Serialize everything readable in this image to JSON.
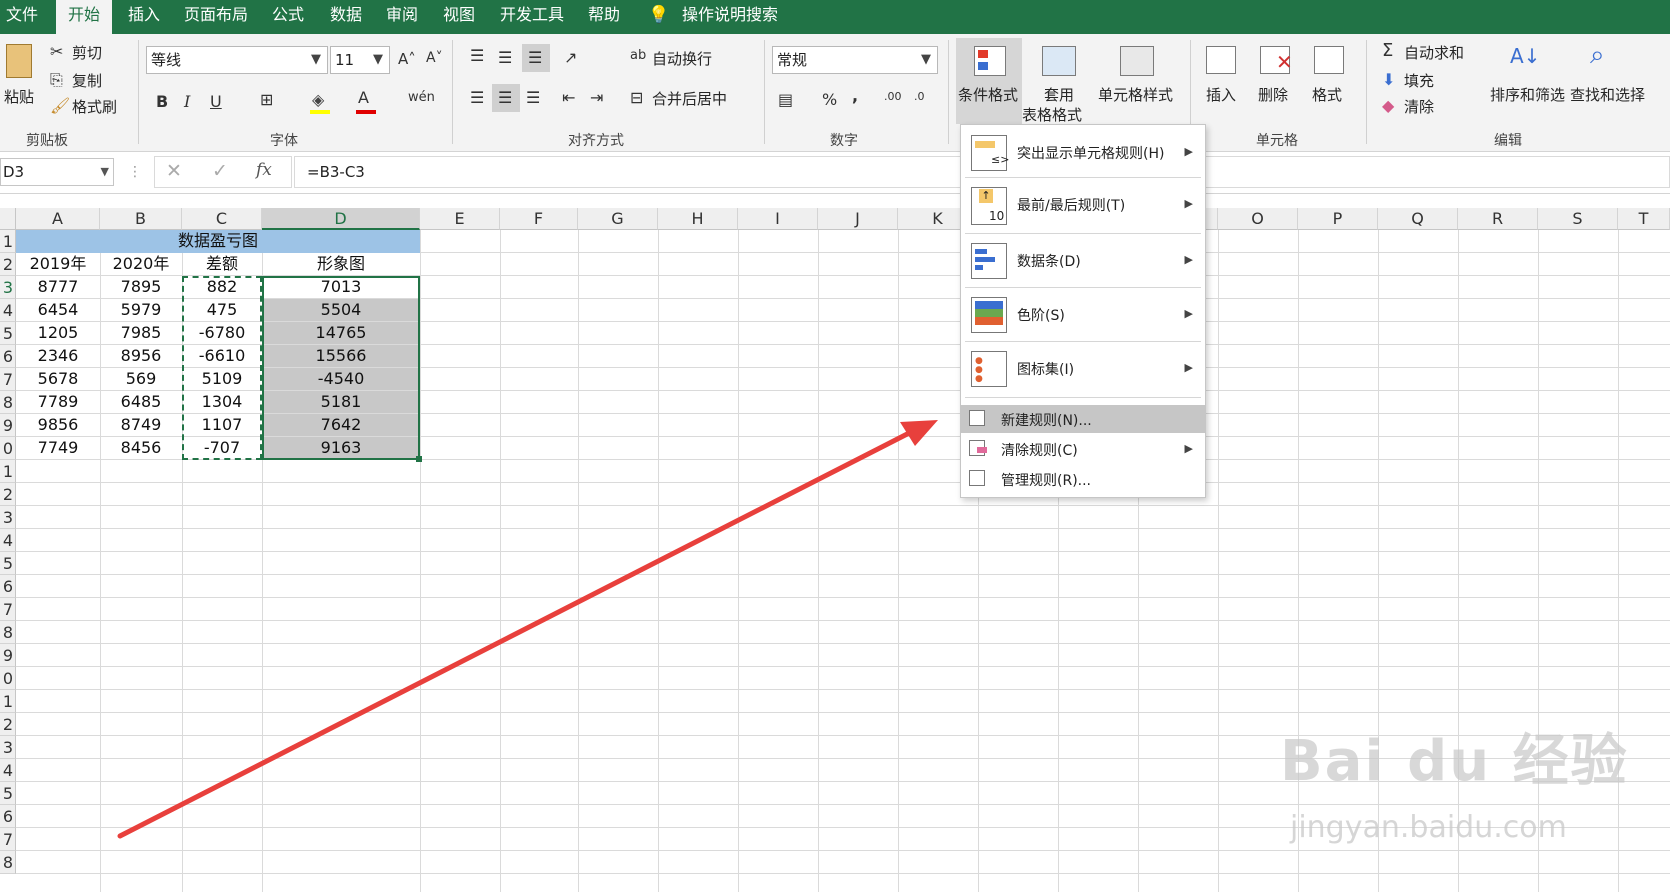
{
  "tabs": [
    "文件",
    "开始",
    "插入",
    "页面布局",
    "公式",
    "数据",
    "审阅",
    "视图",
    "开发工具",
    "帮助"
  ],
  "tell_me": "操作说明搜索",
  "clipboard": {
    "paste": "粘贴",
    "cut": "剪切",
    "copy": "复制",
    "format_painter": "格式刷",
    "group": "剪贴板"
  },
  "font": {
    "name": "等线",
    "size": "11",
    "bold": "B",
    "italic": "I",
    "underline": "U",
    "group": "字体",
    "font_color_letter": "A"
  },
  "alignment": {
    "wrap": "自动换行",
    "merge": "合并后居中",
    "group": "对齐方式"
  },
  "number": {
    "format": "常规",
    "percent": "%",
    "comma": ",",
    "group": "数字"
  },
  "styles": {
    "conditional": "条件格式",
    "table_format_1": "套用",
    "table_format_2": "表格格式",
    "cell_styles": "单元格样式"
  },
  "cells": {
    "insert": "插入",
    "delete": "删除",
    "format": "格式",
    "group": "单元格"
  },
  "editing": {
    "autosum": "自动求和",
    "fill": "填充",
    "clear": "清除",
    "sort_filter": "排序和筛选",
    "find_select": "查找和选择",
    "group": "编辑"
  },
  "formula_bar": {
    "name_box": "D3",
    "formula": "=B3-C3",
    "fx": "fx"
  },
  "columns": [
    "A",
    "B",
    "C",
    "D",
    "E",
    "F",
    "G",
    "H",
    "I",
    "J",
    "K",
    "L",
    "M",
    "N",
    "O",
    "P",
    "Q",
    "R",
    "S",
    "T"
  ],
  "rows": [
    "1",
    "2",
    "3",
    "4",
    "5",
    "6",
    "7",
    "8",
    "9",
    "0",
    "1",
    "2",
    "3",
    "4",
    "5",
    "6",
    "7",
    "8",
    "9",
    "0",
    "1",
    "2",
    "3",
    "4",
    "5",
    "6",
    "7",
    "8"
  ],
  "sheet": {
    "title": "数据盈亏图",
    "headers": [
      "2019年",
      "2020年",
      "差额",
      "形象图"
    ],
    "data": [
      [
        "8777",
        "7895",
        "882",
        "7013"
      ],
      [
        "6454",
        "5979",
        "475",
        "5504"
      ],
      [
        "1205",
        "7985",
        "-6780",
        "14765"
      ],
      [
        "2346",
        "8956",
        "-6610",
        "15566"
      ],
      [
        "5678",
        "569",
        "5109",
        "-4540"
      ],
      [
        "7789",
        "6485",
        "1304",
        "5181"
      ],
      [
        "9856",
        "8749",
        "1107",
        "7642"
      ],
      [
        "7749",
        "8456",
        "-707",
        "9163"
      ]
    ]
  },
  "menu": {
    "items": [
      {
        "label": "突出显示单元格规则(H)",
        "submenu": true
      },
      {
        "label": "最前/最后规则(T)",
        "submenu": true
      },
      {
        "label": "数据条(D)",
        "submenu": true
      },
      {
        "label": "色阶(S)",
        "submenu": true
      },
      {
        "label": "图标集(I)",
        "submenu": true
      }
    ],
    "small_items": [
      {
        "label": "新建规则(N)...",
        "submenu": false,
        "highlighted": true
      },
      {
        "label": "清除规则(C)",
        "submenu": true
      },
      {
        "label": "管理规则(R)...",
        "submenu": false
      }
    ],
    "icon_10": "10"
  },
  "watermark": {
    "logo": "Bai du 经验",
    "url": "jingyan.baidu.com"
  },
  "colors": {
    "excel_green": "#217346",
    "title_fill": "#9dc3e6",
    "selection_fill": "#c8c8c8",
    "arrow": "#e8403c"
  }
}
